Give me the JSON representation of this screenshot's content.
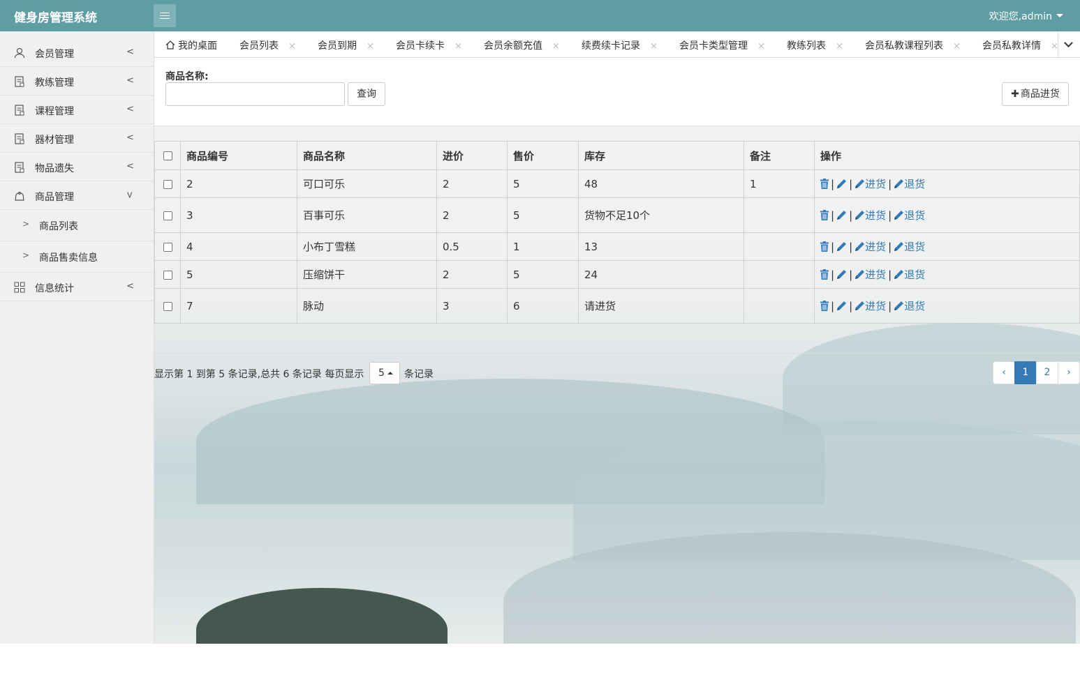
{
  "header": {
    "title": "健身房管理系统",
    "user_menu": "欢迎您,admin"
  },
  "sidebar": {
    "items": [
      {
        "label": "会员管理",
        "icon": "user-icon"
      },
      {
        "label": "教练管理",
        "icon": "doc-icon"
      },
      {
        "label": "课程管理",
        "icon": "doc-icon"
      },
      {
        "label": "器材管理",
        "icon": "doc-icon"
      },
      {
        "label": "物品遗失",
        "icon": "doc-icon"
      },
      {
        "label": "商品管理",
        "icon": "bag-icon"
      }
    ],
    "sub_items": [
      {
        "label": "商品列表"
      },
      {
        "label": "商品售卖信息"
      }
    ],
    "last_item": {
      "label": "信息统计",
      "icon": "grid-icon"
    }
  },
  "tabs": [
    {
      "label": "我的桌面"
    },
    {
      "label": "会员列表"
    },
    {
      "label": "会员到期"
    },
    {
      "label": "会员卡续卡"
    },
    {
      "label": "会员余额充值"
    },
    {
      "label": "续费续卡记录"
    },
    {
      "label": "会员卡类型管理"
    },
    {
      "label": "教练列表"
    },
    {
      "label": "会员私教课程列表"
    },
    {
      "label": "会员私教详情"
    }
  ],
  "tab_close": "×",
  "search": {
    "label": "商品名称:",
    "value": "",
    "query_button": "查询",
    "stock_button": "商品进货"
  },
  "table": {
    "columns": [
      "商品编号",
      "商品名称",
      "进价",
      "售价",
      "库存",
      "备注",
      "操作"
    ],
    "rows": [
      {
        "id": "2",
        "name": "可口可乐",
        "cost": "2",
        "price": "5",
        "stock": "48",
        "note": "1",
        "stock_warn": false
      },
      {
        "id": "3",
        "name": "百事可乐",
        "cost": "2",
        "price": "5",
        "stock": "货物不足10个",
        "note": "",
        "stock_warn": true
      },
      {
        "id": "4",
        "name": "小布丁雪糕",
        "cost": "0.5",
        "price": "1",
        "stock": "13",
        "note": "",
        "stock_warn": false
      },
      {
        "id": "5",
        "name": "压缩饼干",
        "cost": "2",
        "price": "5",
        "stock": "24",
        "note": "",
        "stock_warn": false
      },
      {
        "id": "7",
        "name": "脉动",
        "cost": "3",
        "price": "6",
        "stock": "请进货",
        "note": "",
        "stock_warn": true
      }
    ],
    "actions": {
      "restock": "进货",
      "return": "退货",
      "separator": "|"
    }
  },
  "pagination": {
    "info": "显示第 1 到第 5 条记录,总共 6 条记录 每页显示",
    "page_size": "5",
    "records_suffix": "条记录",
    "prev": "‹",
    "pages": [
      "1",
      "2"
    ],
    "next": "›",
    "current": "1"
  },
  "colors": {
    "header": "#5e9ea3",
    "link": "#337ab7",
    "warn": "#e21b1b"
  }
}
